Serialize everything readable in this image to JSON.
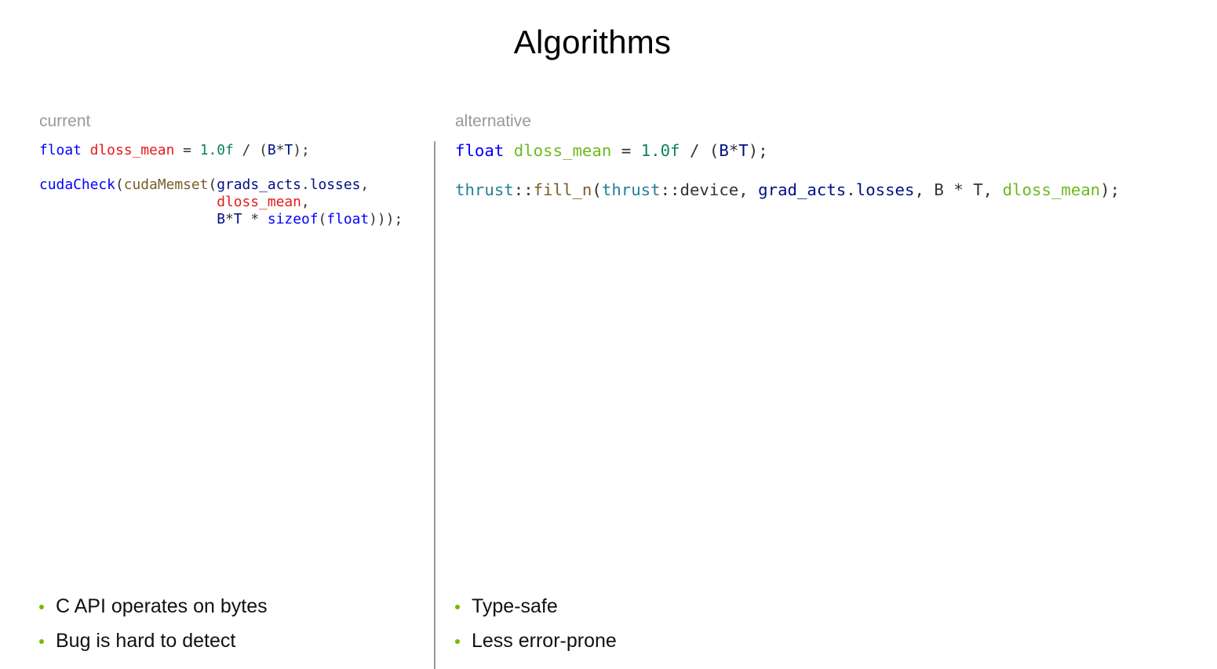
{
  "slide": {
    "title": "Algorithms"
  },
  "left": {
    "label": "current",
    "code": {
      "l1": {
        "kw": "float",
        "var": "dloss_mean",
        "op": " = ",
        "num": "1.0f",
        "rest": " / (",
        "b": "B",
        "star": "*",
        "t": "T",
        "close": ");"
      },
      "l2": {
        "fn1": "cudaCheck",
        "p1": "(",
        "fn2": "cudaMemset",
        "p2": "(",
        "obj": "grads_acts",
        "dot": ".",
        "mem": "losses",
        "comma": ","
      },
      "l3": {
        "var": "dloss_mean",
        "comma": ","
      },
      "l4": {
        "b": "B",
        "star": "*",
        "t": "T",
        "mul": " * ",
        "kw": "sizeof",
        "p": "(",
        "kw2": "float",
        "close": ")));"
      }
    },
    "bullets": [
      "C API operates on bytes",
      "Bug is hard to detect"
    ]
  },
  "right": {
    "label": "alternative",
    "code": {
      "l1": {
        "kw": "float",
        "var": "dloss_mean",
        "op": " = ",
        "num": "1.0f",
        "rest": " / (",
        "b": "B",
        "star": "*",
        "t": "T",
        "close": ");"
      },
      "l2": {
        "ns1": "thrust",
        "sep1": "::",
        "fn": "fill_n",
        "p": "(",
        "ns2": "thrust",
        "sep2": "::",
        "dev": "device, ",
        "obj": "grad_acts",
        "dot": ".",
        "mem": "losses",
        "args": ", B * T, ",
        "var": "dloss_mean",
        "close": ");"
      }
    },
    "bullets": [
      "Type-safe",
      "Less error-prone"
    ]
  },
  "colors": {
    "keyword": "#0000ff",
    "variable_current": "#e51a1a",
    "variable_alternative": "#6eb81f",
    "number": "#098658",
    "function": "#795e26",
    "member": "#001080",
    "namespace": "#267f99",
    "bullet": "#76b900",
    "label": "#999999"
  }
}
